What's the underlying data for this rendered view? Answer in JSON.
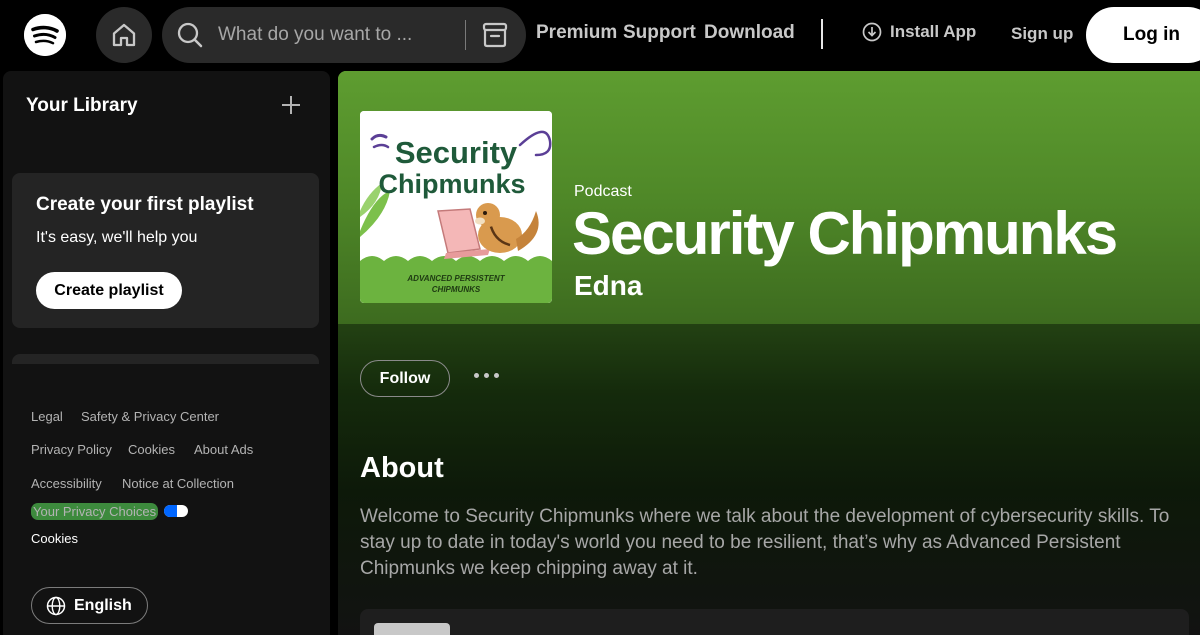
{
  "topbar": {
    "search_placeholder": "What do you want to ...",
    "nav_links": [
      "Premium",
      "Support",
      "Download"
    ],
    "install_label": "Install App",
    "signup_label": "Sign up",
    "login_label": "Log in"
  },
  "sidebar": {
    "library_title": "Your Library",
    "create_card": {
      "title": "Create your first playlist",
      "subtitle": "It's easy, we'll help you",
      "button_label": "Create playlist"
    },
    "footer_links": [
      "Legal",
      "Safety & Privacy Center",
      "Privacy Policy",
      "Cookies",
      "About Ads",
      "Accessibility",
      "Notice at Collection"
    ],
    "privacy_choices": "Your Privacy Choices",
    "cookies_label": "Cookies",
    "language_label": "English"
  },
  "show": {
    "type_label": "Podcast",
    "title": "Security Chipmunks",
    "author": "Edna",
    "cover": {
      "title_line1": "Security",
      "title_line2": "Chipmunks",
      "caption_line1": "ADVANCED PERSISTENT",
      "caption_line2": "CHIPMUNKS"
    },
    "follow_label": "Follow",
    "about_heading": "About",
    "about_text": "Welcome to Security Chipmunks where we talk about the development of cybersecurity skills. To stay up to date in today's world you need to be resilient, that’s why as Advanced Persistent Chipmunks we keep chipping away at it."
  },
  "colors": {
    "brand_green": "#5d9c30",
    "background": "#121212",
    "surface": "#242424",
    "cover_title": "#1f5a3a",
    "cover_green": "#6cb33f"
  }
}
